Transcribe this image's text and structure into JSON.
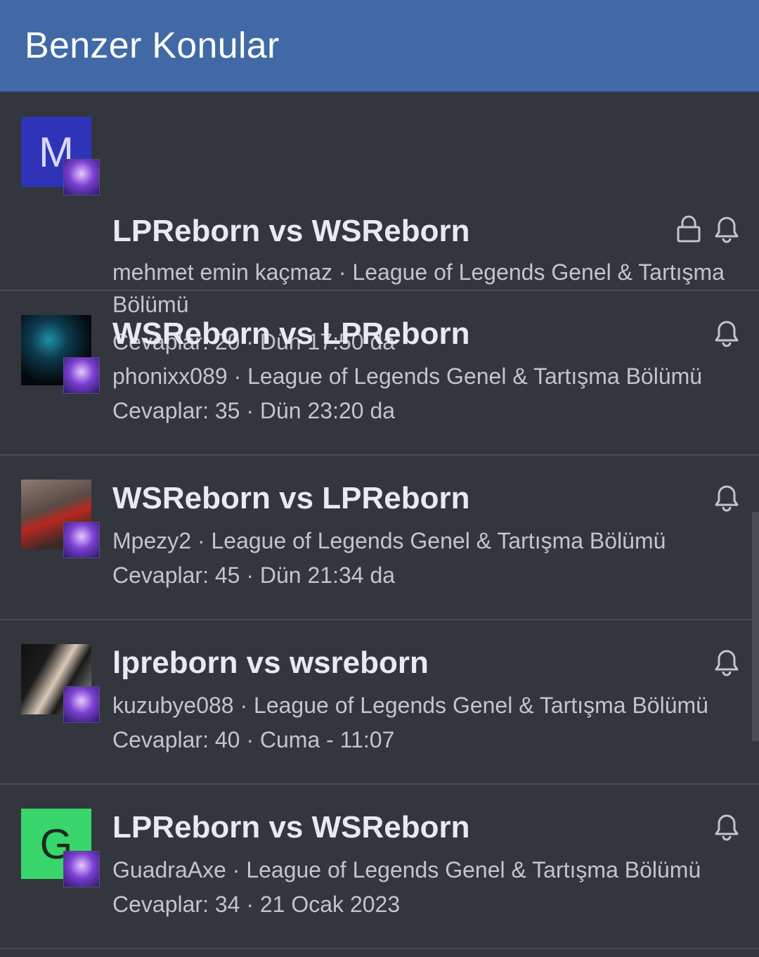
{
  "header": {
    "title": "Benzer Konular"
  },
  "threads": [
    {
      "avatar": "M",
      "title": "LPReborn vs WSReborn",
      "author": "mehmet emin kaçmaz",
      "forum": "League of Legends Genel & Tartışma Bölümü",
      "replies": "Cevaplar: 20",
      "date": "Dün 17:50 da",
      "locked": true
    },
    {
      "avatar": "",
      "title": "WSReborn vs LPReborn",
      "author": "phonixx089",
      "forum": "League of Legends Genel & Tartışma Bölümü",
      "replies": "Cevaplar: 35",
      "date": "Dün 23:20 da",
      "locked": false
    },
    {
      "avatar": "",
      "title": "WSReborn vs LPReborn",
      "author": "Mpezy2",
      "forum": "League of Legends Genel & Tartışma Bölümü",
      "replies": "Cevaplar: 45",
      "date": "Dün 21:34 da",
      "locked": false
    },
    {
      "avatar": "",
      "title": "lpreborn vs wsreborn",
      "author": "kuzubye088",
      "forum": "League of Legends Genel & Tartışma Bölümü",
      "replies": "Cevaplar: 40",
      "date": "Cuma - 11:07",
      "locked": false
    },
    {
      "avatar": "G",
      "title": "LPReborn vs WSReborn",
      "author": "GuadraAxe",
      "forum": "League of Legends Genel & Tartışma Bölümü",
      "replies": "Cevaplar: 34",
      "date": "21 Ocak 2023",
      "locked": false
    }
  ],
  "separator": " · ",
  "icons": {
    "lock": "lock-icon",
    "bell": "bell-icon"
  },
  "colors": {
    "header": "#4169a6",
    "background": "#33363d"
  }
}
